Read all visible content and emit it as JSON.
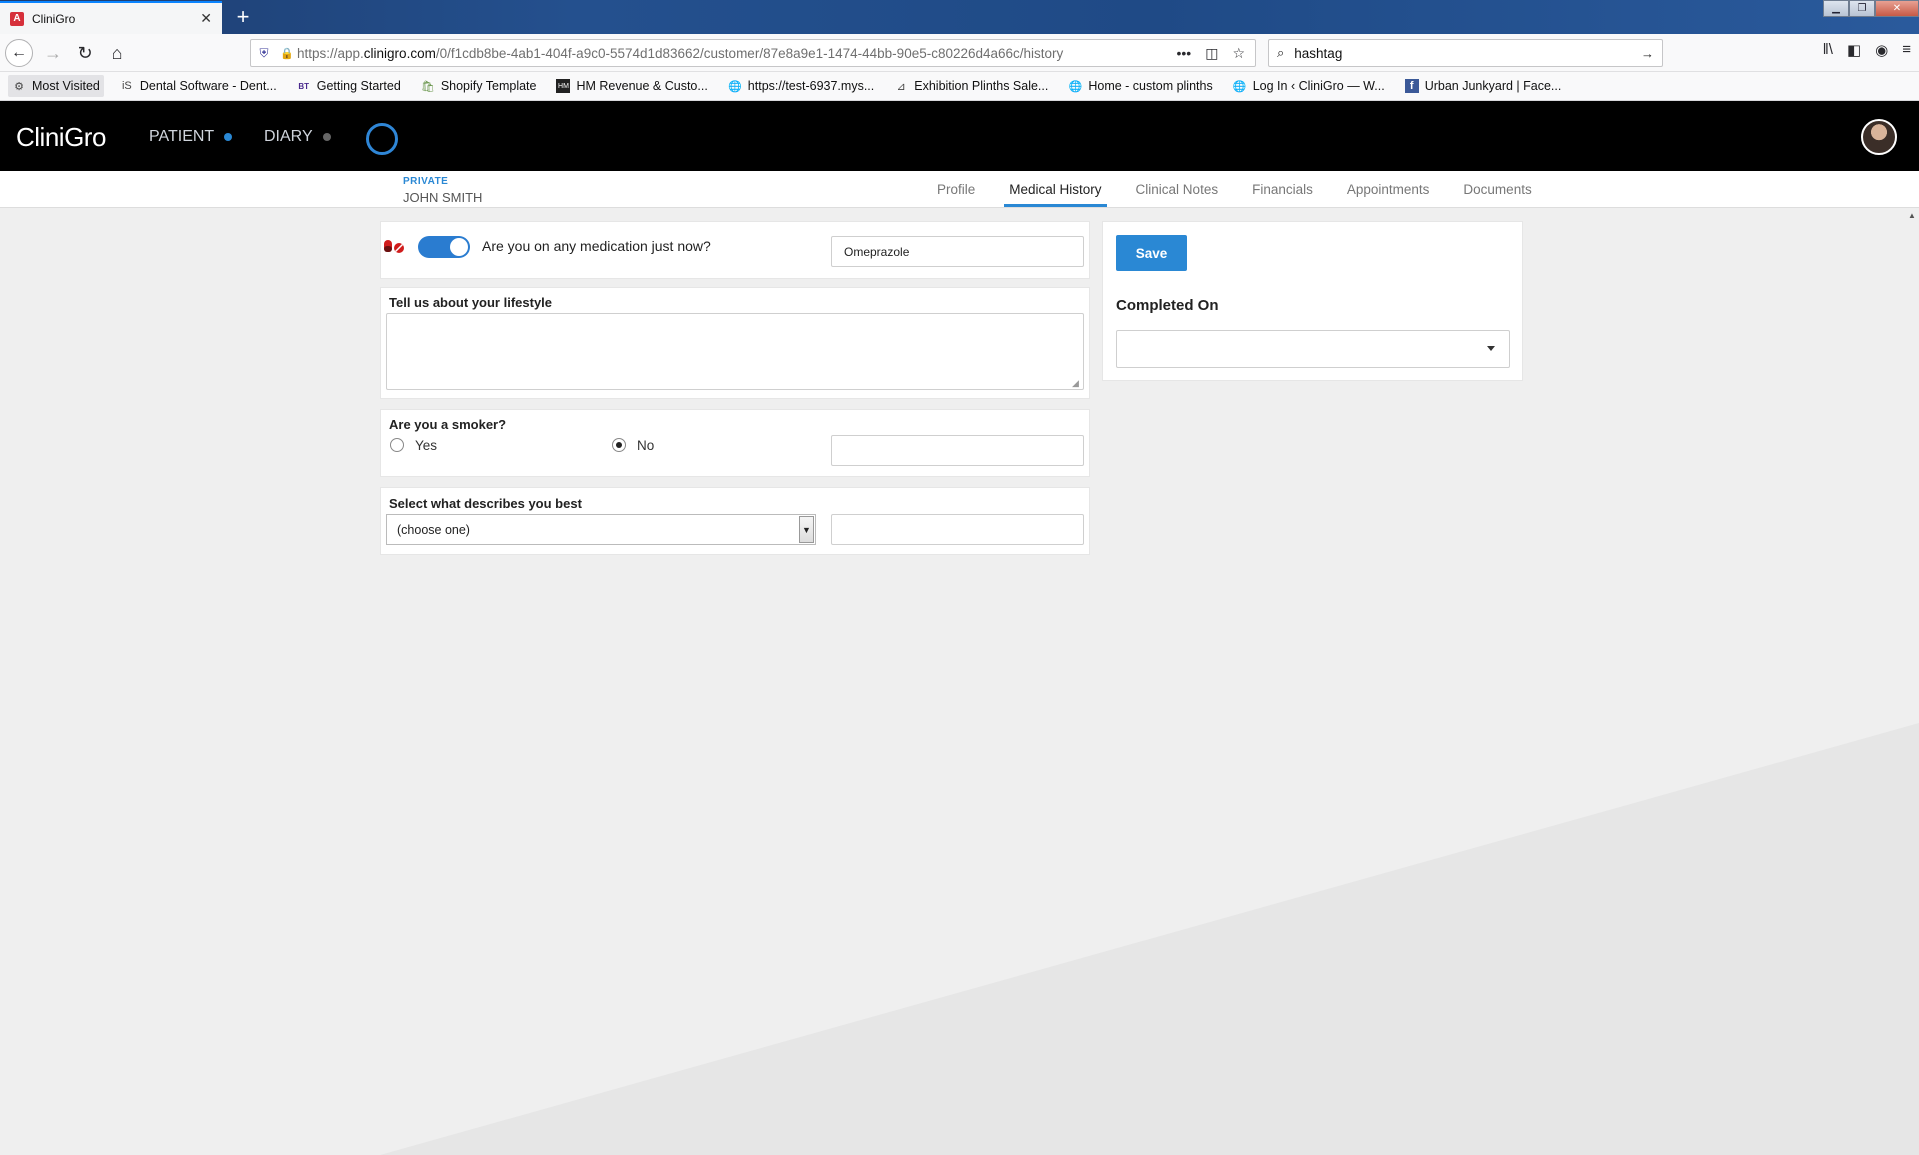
{
  "browser": {
    "tab_title": "CliniGro",
    "url_prefix": "https://app.",
    "url_domain": "clinigro.com",
    "url_path": "/0/f1cdb8be-4ab1-404f-a9c0-5574d1d83662/customer/87e8a9e1-1474-44bb-90e5-c80226d4a66c/history",
    "search_value": "hashtag",
    "bookmarks": [
      {
        "label": "Most Visited",
        "icon": "gear-icon"
      },
      {
        "label": "Dental Software - Dent...",
        "icon": "is-logo-icon"
      },
      {
        "label": "Getting Started",
        "icon": "bt-logo-icon"
      },
      {
        "label": "Shopify Template",
        "icon": "shopify-icon"
      },
      {
        "label": "HM Revenue & Custo...",
        "icon": "hmrc-icon"
      },
      {
        "label": "https://test-6937.mys...",
        "icon": "globe-icon"
      },
      {
        "label": "Exhibition Plinths Sale...",
        "icon": "plinth-icon"
      },
      {
        "label": "Home - custom plinths",
        "icon": "globe-icon"
      },
      {
        "label": "Log In ‹ CliniGro — W...",
        "icon": "globe-icon"
      },
      {
        "label": "Urban Junkyard | Face...",
        "icon": "facebook-icon"
      }
    ]
  },
  "app": {
    "logo": "CliniGro",
    "menu": [
      {
        "label": "PATIENT",
        "dot_color": "#2a88d4"
      },
      {
        "label": "DIARY",
        "dot_color": "#666666"
      }
    ],
    "accent_color": "#2a88d4"
  },
  "patient": {
    "type": "PRIVATE",
    "name": "JOHN SMITH"
  },
  "tabs": [
    {
      "label": "Profile",
      "active": false
    },
    {
      "label": "Medical History",
      "active": true
    },
    {
      "label": "Clinical Notes",
      "active": false
    },
    {
      "label": "Financials",
      "active": false
    },
    {
      "label": "Appointments",
      "active": false
    },
    {
      "label": "Documents",
      "active": false
    }
  ],
  "form": {
    "medication": {
      "question": "Are you on any medication just now?",
      "enabled": true,
      "value": "Omeprazole"
    },
    "lifestyle": {
      "question": "Tell us about your lifestyle",
      "value": ""
    },
    "smoker": {
      "question": "Are you a smoker?",
      "options": [
        "Yes",
        "No"
      ],
      "selected": "No",
      "note": ""
    },
    "describe": {
      "question": "Select what describes you best",
      "selected": "(choose one)",
      "note": ""
    }
  },
  "sidebar": {
    "save_label": "Save",
    "completed_label": "Completed On",
    "completed_value": ""
  }
}
